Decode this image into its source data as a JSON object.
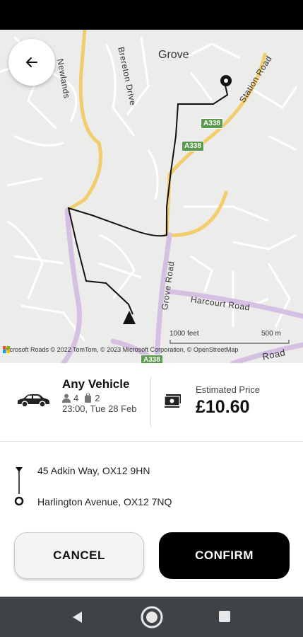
{
  "map": {
    "place_label": "Grove",
    "roads": {
      "newlands": "Newlands",
      "brereton_drive": "Brereton Drive",
      "station_road": "Station Road",
      "grove_road": "Grove Road",
      "harcourt_road": "Harcourt Road",
      "road_partial": "Road"
    },
    "shields": [
      "A338",
      "A338",
      "A338"
    ],
    "scale_feet": "1000 feet",
    "scale_m": "500 m",
    "attribution": "Microsoft Roads © 2022 TomTom, © 2023 Microsoft Corporation, © OpenStreetMap"
  },
  "vehicle": {
    "name": "Any Vehicle",
    "passengers": "4",
    "luggage": "2",
    "time": "23:00, Tue 28 Feb"
  },
  "price": {
    "label": "Estimated Price",
    "value": "£10.60"
  },
  "route": {
    "pickup": "45 Adkin Way, OX12 9HN",
    "dropoff": "Harlington Avenue, OX12 7NQ"
  },
  "actions": {
    "cancel": "CANCEL",
    "confirm": "CONFIRM"
  },
  "icons": {
    "back": "arrow-left-icon",
    "car": "car-icon",
    "cash": "cash-icon"
  }
}
